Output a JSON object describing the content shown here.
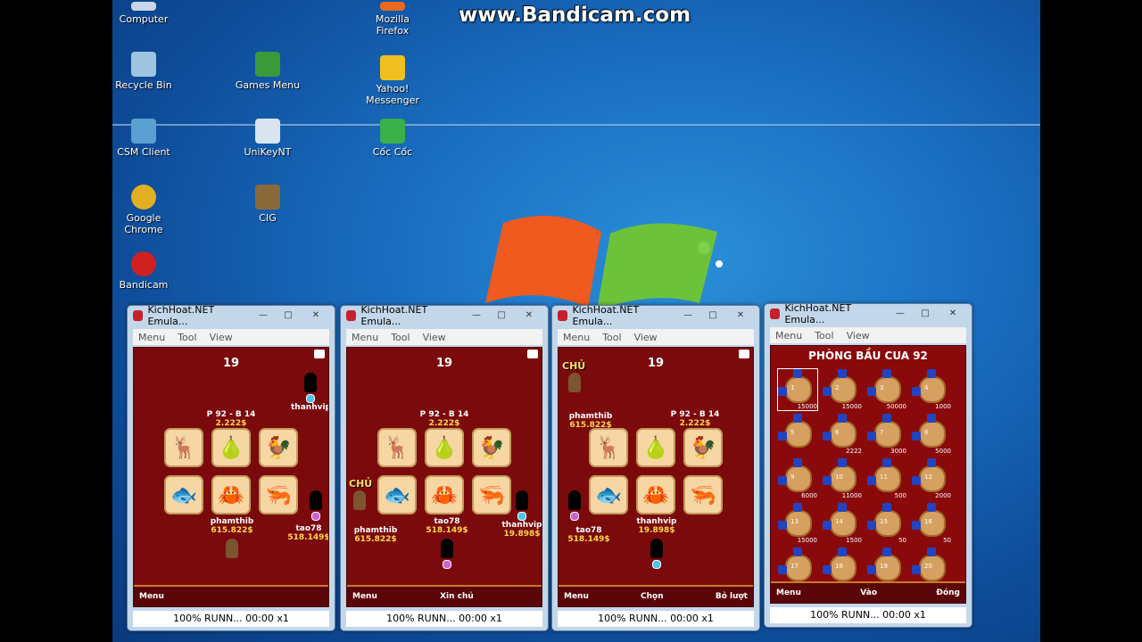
{
  "watermark": "www.Bandicam.com",
  "desktop_icons": [
    {
      "label": "Computer",
      "icon": "computer-icon",
      "color": "#c9d6e6"
    },
    {
      "label": "Mozilla Firefox",
      "icon": "firefox-icon",
      "color": "#e66a1f"
    },
    {
      "label": "Recycle Bin",
      "icon": "recycle-bin-icon",
      "color": "#9fc4e0"
    },
    {
      "label": "Games Menu",
      "icon": "games-menu-icon",
      "color": "#3a9a3a"
    },
    {
      "label": "Yahoo! Messenger",
      "icon": "yahoo-messenger-icon",
      "color": "#f0c020"
    },
    {
      "label": "CSM Client",
      "icon": "csm-client-icon",
      "color": "#5aa0d0"
    },
    {
      "label": "UniKeyNT",
      "icon": "unikey-icon",
      "color": "#d8e4f0"
    },
    {
      "label": "Cốc Cốc",
      "icon": "coccoc-icon",
      "color": "#3ab04a"
    },
    {
      "label": "Google Chrome",
      "icon": "chrome-icon",
      "color": "#e0b020"
    },
    {
      "label": "CIG",
      "icon": "cig-icon",
      "color": "#8a6a3a"
    },
    {
      "label": "Bandicam",
      "icon": "bandicam-icon",
      "color": "#d02020"
    }
  ],
  "window": {
    "title": "KichHoat.NET Emula...",
    "menu": [
      "Menu",
      "Tool",
      "View"
    ],
    "min": "—",
    "max": "□",
    "close": "✕",
    "status": "100% RUNN... 00:00 x1"
  },
  "games": [
    {
      "round": "19",
      "room": "P 92 - B 14",
      "pot": "2.222$",
      "players": [
        {
          "name": "thanhvip",
          "money": ""
        },
        {
          "name": "phamthib",
          "money": "615.822$"
        },
        {
          "name": "tao78",
          "money": "518.149$"
        }
      ],
      "softkeys": {
        "left": "Menu",
        "center": "",
        "right": ""
      }
    },
    {
      "round": "19",
      "room": "P 92 - B 14",
      "pot": "2.222$",
      "chu": "CHỦ",
      "players": [
        {
          "name": "phamthib",
          "money": "615.822$"
        },
        {
          "name": "tao78",
          "money": "518.149$"
        },
        {
          "name": "thanhvip",
          "money": "19.898$"
        }
      ],
      "softkeys": {
        "left": "Menu",
        "center": "Xin chủ",
        "right": ""
      }
    },
    {
      "round": "19",
      "room": "P 92 - B 14",
      "pot": "2.222$",
      "chu": "CHỦ",
      "players": [
        {
          "name": "phamthib",
          "money": "615.822$"
        },
        {
          "name": "thanhvip",
          "money": "19.898$"
        },
        {
          "name": "tao78",
          "money": "518.149$"
        }
      ],
      "softkeys": {
        "left": "Menu",
        "center": "Chọn",
        "right": "Bỏ lượt"
      }
    }
  ],
  "tiles": [
    "🦌",
    "🍐",
    "🐓",
    "🐟",
    "🦀",
    "🦐"
  ],
  "tile_names": [
    "deer-tile",
    "gourd-tile",
    "rooster-tile",
    "fish-tile",
    "crab-tile",
    "shrimp-tile"
  ],
  "lobby": {
    "title": "PHÒNG BẦU CUA 92",
    "rooms": [
      {
        "num": "1",
        "bet": "15000"
      },
      {
        "num": "2",
        "bet": "15000"
      },
      {
        "num": "3",
        "bet": "50000"
      },
      {
        "num": "4",
        "bet": "1000"
      },
      {
        "num": "5",
        "bet": ""
      },
      {
        "num": "6",
        "bet": "2222"
      },
      {
        "num": "7",
        "bet": "3000"
      },
      {
        "num": "8",
        "bet": "5000"
      },
      {
        "num": "9",
        "bet": "6000"
      },
      {
        "num": "10",
        "bet": "11000"
      },
      {
        "num": "11",
        "bet": "500"
      },
      {
        "num": "12",
        "bet": "2000"
      },
      {
        "num": "13",
        "bet": "15000"
      },
      {
        "num": "14",
        "bet": "1500"
      },
      {
        "num": "15",
        "bet": "50"
      },
      {
        "num": "16",
        "bet": "50"
      },
      {
        "num": "17",
        "bet": ""
      },
      {
        "num": "18",
        "bet": ""
      },
      {
        "num": "19",
        "bet": ""
      },
      {
        "num": "20",
        "bet": ""
      }
    ],
    "softkeys": {
      "left": "Menu",
      "center": "Vào",
      "right": "Đóng"
    }
  }
}
